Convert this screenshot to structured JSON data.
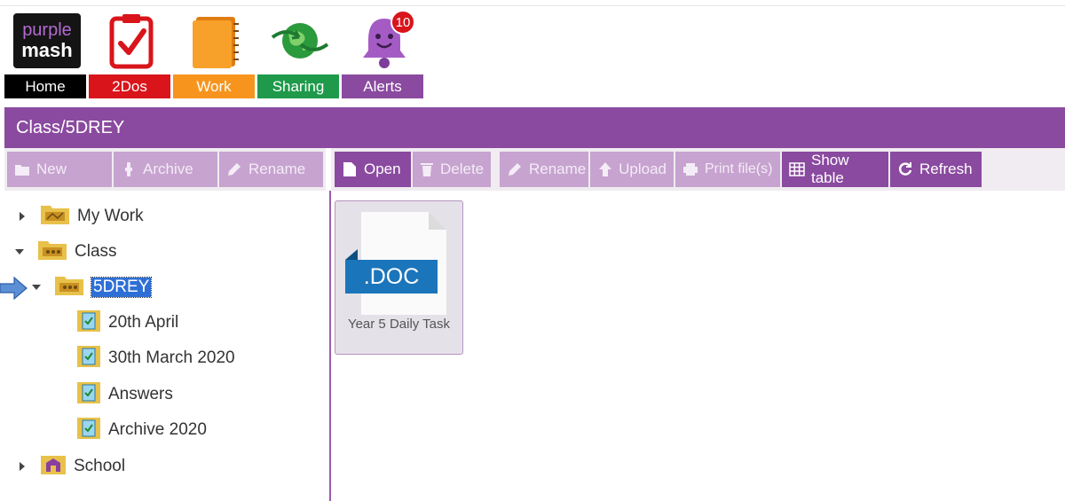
{
  "nav": {
    "items": [
      {
        "label": "Home",
        "color": "#000000",
        "icon": "purple-mash-logo-icon",
        "logo_text_top": "purple",
        "logo_text_bottom": "mash"
      },
      {
        "label": "2Dos",
        "color": "#d9141b",
        "icon": "clipboard-check-icon"
      },
      {
        "label": "Work",
        "color": "#f7941d",
        "icon": "folder-icon"
      },
      {
        "label": "Sharing",
        "color": "#1e9a4a",
        "icon": "globe-icon"
      },
      {
        "label": "Alerts",
        "color": "#8a4a9f",
        "icon": "bell-icon",
        "badge": "10"
      }
    ]
  },
  "path": {
    "text": "Class/5DREY"
  },
  "left_toolbar": {
    "new_label": "New",
    "archive_label": "Archive",
    "rename_label": "Rename"
  },
  "right_toolbar": {
    "open_label": "Open",
    "delete_label": "Delete",
    "rename_label": "Rename",
    "upload_label": "Upload",
    "print_label": "Print file(s)",
    "show_table_label": "Show table",
    "refresh_label": "Refresh"
  },
  "tree": {
    "my_work": "My Work",
    "class": "Class",
    "selected": "5DREY",
    "children": [
      "20th April",
      "30th March 2020",
      "Answers",
      "Archive 2020"
    ],
    "school": "School"
  },
  "files": [
    {
      "name": "Year 5 Daily Task",
      "ext": ".DOC"
    }
  ],
  "colors": {
    "accent": "#8a4a9f",
    "toolbar_button": "#c7a3d0",
    "selection": "#2e6fd6",
    "doc_blue": "#1b75bb"
  }
}
